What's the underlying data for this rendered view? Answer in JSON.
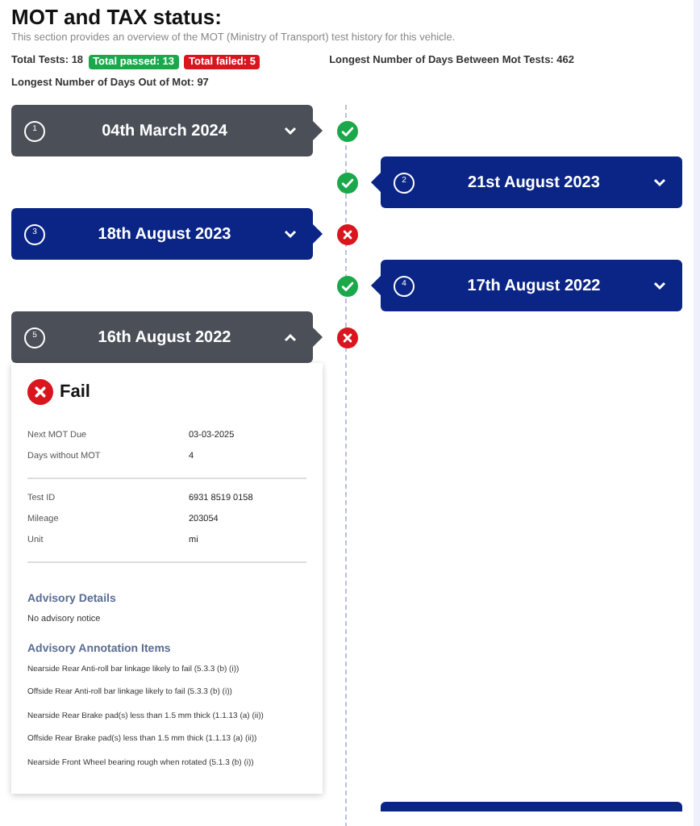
{
  "header": {
    "title": "MOT and TAX status:",
    "subtitle": "This section provides an overview of the MOT (Ministry of Transport) test history for this vehicle.",
    "total_tests": "Total Tests: 18",
    "total_passed": "Total passed: 13",
    "total_failed": "Total failed: 5",
    "longest_between": "Longest Number of Days Between Mot Tests: 462",
    "longest_out": "Longest Number of Days Out of Mot: 97"
  },
  "tests": [
    {
      "number": "1",
      "date": "04th March 2024",
      "right_side": false,
      "passed": true,
      "highlighted": true,
      "expanded": false
    },
    {
      "number": "2",
      "date": "21st August 2023",
      "right_side": true,
      "passed": true,
      "highlighted": false,
      "expanded": false
    },
    {
      "number": "3",
      "date": "18th August 2023",
      "right_side": false,
      "passed": false,
      "highlighted": false,
      "expanded": false
    },
    {
      "number": "4",
      "date": "17th August 2022",
      "right_side": true,
      "passed": true,
      "highlighted": false,
      "expanded": false
    },
    {
      "number": "5",
      "date": "16th August 2022",
      "right_side": false,
      "passed": false,
      "highlighted": true,
      "expanded": true,
      "details": {
        "result_label": "Fail",
        "passed": false,
        "groups": [
          [
            {
              "label": "Next MOT Due",
              "value": "03-03-2025"
            },
            {
              "label": "Days without MOT",
              "value": "4"
            }
          ],
          [
            {
              "label": "Test ID",
              "value": "6931 8519 0158"
            },
            {
              "label": "Mileage",
              "value": "203054"
            },
            {
              "label": "Unit",
              "value": "mi"
            }
          ]
        ],
        "advisory_title": "Advisory Details",
        "advisory_text": "No advisory notice",
        "annotation_title": "Advisory Annotation Items",
        "annotations": [
          "Nearside Rear Anti-roll bar linkage likely to fail (5.3.3 (b) (i))",
          "Offside Rear Anti-roll bar linkage likely to fail (5.3.3 (b) (i))",
          "Nearside Rear Brake pad(s) less than 1.5 mm thick (1.1.13 (a) (ii))",
          "Offside Rear Brake pad(s) less than 1.5 mm thick (1.1.13 (a) (ii))",
          "Nearside Front Wheel bearing rough when rotated (5.1.3 (b) (i))"
        ]
      }
    },
    {
      "highlighted": false
    }
  ]
}
